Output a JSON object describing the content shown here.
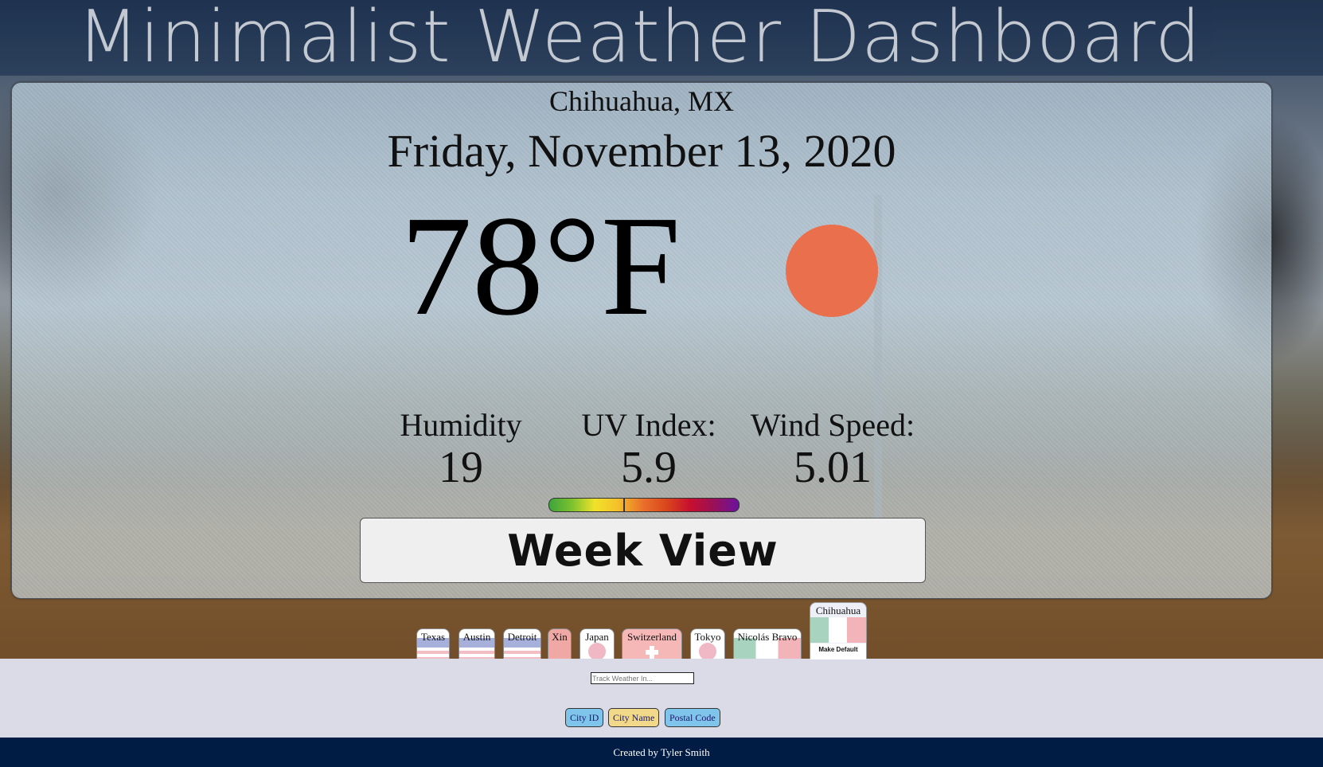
{
  "header": {
    "title": "Minimalist Weather Dashboard"
  },
  "current": {
    "location": "Chihuahua, MX",
    "date": "Friday, November 13, 2020",
    "temperature": "78°F",
    "icon": "sun-icon",
    "humidity_label": "Humidity",
    "humidity_value": "19",
    "uv_label": "UV Index:",
    "uv_value": "5.9",
    "wind_label": "Wind Speed:",
    "wind_value": "5.01",
    "uv_level": 0.39,
    "colors": {
      "sun": "#ea6f4c"
    }
  },
  "week_button": "Week View",
  "cities": [
    {
      "label": "Texas"
    },
    {
      "label": "Austin"
    },
    {
      "label": "Detroit"
    },
    {
      "label": "Xin"
    },
    {
      "label": "Japan"
    },
    {
      "label": "Switzerland"
    },
    {
      "label": "Tokyo"
    },
    {
      "label": "Nicolás Bravo"
    },
    {
      "label": "Chihuahua",
      "make_default": "Make Default"
    }
  ],
  "search": {
    "placeholder": "Track Weather In...",
    "modes": [
      "City ID",
      "City Name",
      "Postal Code"
    ]
  },
  "footer": {
    "credit": "Created by Tyler Smith"
  }
}
